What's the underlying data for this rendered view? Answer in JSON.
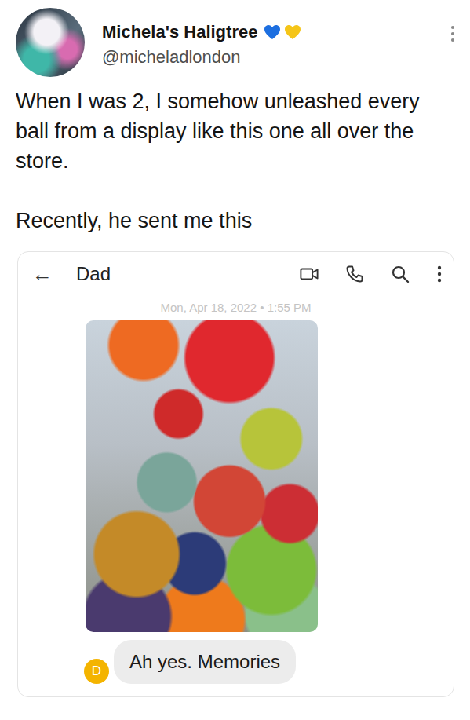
{
  "post": {
    "author": {
      "name": "Michela's Haligtree",
      "handle": "@micheladlondon",
      "badges": [
        {
          "color": "#1d6fe0"
        },
        {
          "color": "#f5c518"
        }
      ]
    },
    "paragraphs": [
      "When I was 2, I somehow unleashed every ball from a display like this one all over the store.",
      "Recently, he sent me this"
    ]
  },
  "conversation": {
    "contact": "Dad",
    "back": "←",
    "timestamp": "Mon, Apr 18, 2022 • 1:55 PM",
    "messages": [
      {
        "sender_initial": "D",
        "text": "Ah yes. Memories"
      }
    ]
  }
}
